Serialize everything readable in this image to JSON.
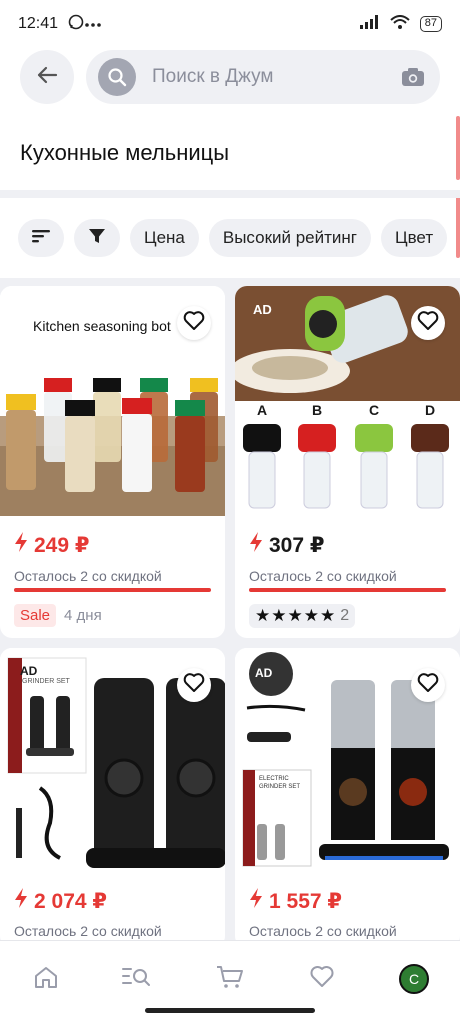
{
  "status_bar": {
    "time": "12:41",
    "dots": "···",
    "battery": "87"
  },
  "search": {
    "placeholder": "Поиск в Джум"
  },
  "page": {
    "title": "Кухонные мельницы"
  },
  "filters": {
    "chips": [
      "Цена",
      "Высокий рейтинг",
      "Цвет"
    ]
  },
  "products": [
    {
      "price": "249 ₽",
      "stock": "Осталось 2 со скидкой",
      "sale_tag": "Sale",
      "sale_days": "4 дня",
      "image_caption": "Kitchen seasoning bot"
    },
    {
      "price": "307 ₽",
      "stock": "Осталось 2 со скидкой",
      "rating_count": "2",
      "image_badge": "AD",
      "variants": [
        "A",
        "B",
        "C",
        "D"
      ]
    },
    {
      "price": "2 074 ₽",
      "stock": "Осталось 2 со скидкой",
      "image_badge": "AD",
      "box_text": "GRINDER SET"
    },
    {
      "price": "1 557 ₽",
      "stock": "Осталось 2 со скидкой",
      "image_badge": "AD",
      "box_text_line1": "ELECTRIC",
      "box_text_line2": "GRINDER SET"
    }
  ],
  "colors": {
    "accent_red": "#e53935",
    "background": "#eff0f4",
    "active_nav": "#2e7d32"
  },
  "nav": {
    "profile_initial": "С"
  },
  "icons": [
    "back-arrow-icon",
    "search-icon",
    "camera-icon",
    "sort-icon",
    "filter-icon",
    "heart-icon",
    "lightning-icon",
    "home-icon",
    "catalog-icon",
    "cart-icon",
    "favorites-icon",
    "profile-icon"
  ]
}
